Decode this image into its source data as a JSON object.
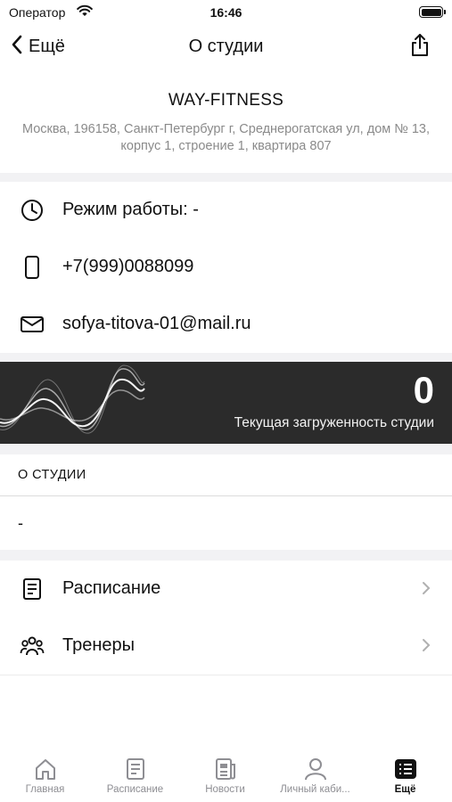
{
  "status_bar": {
    "carrier": "Оператор",
    "time": "16:46"
  },
  "nav": {
    "back_label": "Ещё",
    "title": "О студии"
  },
  "studio": {
    "name": "WAY-FITNESS",
    "address": "Москва, 196158, Санкт-Петербург г, Среднерогатская ул, дом № 13, корпус 1, строение 1, квартира 807"
  },
  "contacts": {
    "hours": "Режим работы: -",
    "phone": "+7(999)0088099",
    "email": "sofya-titova-01@mail.ru"
  },
  "load": {
    "value": "0",
    "label": "Текущая загруженность студии"
  },
  "about": {
    "heading": "О СТУДИИ",
    "text": "-"
  },
  "links": [
    {
      "label": "Расписание",
      "icon": "document-icon"
    },
    {
      "label": "Тренеры",
      "icon": "people-icon"
    }
  ],
  "tabs": [
    {
      "label": "Главная",
      "icon": "home-icon"
    },
    {
      "label": "Расписание",
      "icon": "document-icon"
    },
    {
      "label": "Новости",
      "icon": "news-icon"
    },
    {
      "label": "Личный каби...",
      "icon": "person-icon"
    },
    {
      "label": "Ещё",
      "icon": "list-icon",
      "active": true
    }
  ]
}
